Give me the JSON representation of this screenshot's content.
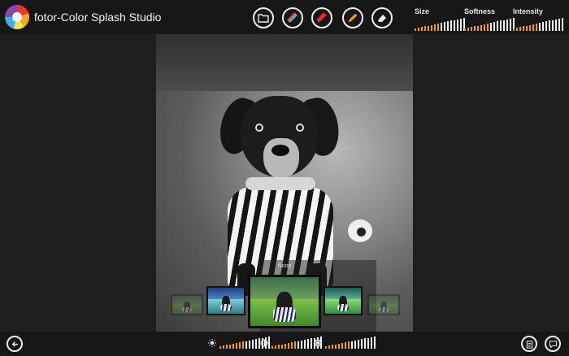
{
  "app": {
    "title": "fotor-Color Splash Studio"
  },
  "toolbar": {
    "tools": [
      {
        "name": "open-folder-icon"
      },
      {
        "name": "color-brush-icon"
      },
      {
        "name": "red-brush-icon"
      },
      {
        "name": "pencil-icon"
      },
      {
        "name": "eraser-icon"
      }
    ],
    "sliders": [
      {
        "label": "Size",
        "level": 0.5
      },
      {
        "label": "Softness",
        "level": 0.5
      },
      {
        "label": "Intensity",
        "level": 0.5
      }
    ]
  },
  "filter_strip": {
    "selected_label": "None",
    "filters": [
      "faded",
      "blue",
      "original",
      "teal",
      "faded"
    ]
  },
  "bottom": {
    "adjustments": [
      {
        "icon": "brightness-icon",
        "level": 0.5
      },
      {
        "icon": "contrast-icon",
        "level": 0.5
      },
      {
        "icon": "saturation-icon",
        "level": 0.5
      }
    ],
    "buttons": [
      "back-arrow-icon",
      "clipboard-icon",
      "message-icon"
    ]
  },
  "colors": {
    "accent": "#f39a1e",
    "inactive": "#f2f2f2"
  }
}
